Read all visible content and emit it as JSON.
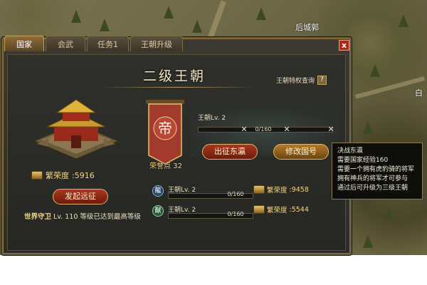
{
  "map": {
    "place_text": "后城郭",
    "side_text": "白"
  },
  "tabs": [
    {
      "label": "国家",
      "active": true
    },
    {
      "label": "会武",
      "active": false
    },
    {
      "label": "任务1",
      "active": false
    },
    {
      "label": "王朝升级",
      "active": false
    }
  ],
  "close_label": "x",
  "dynasty": {
    "title": "二级王朝",
    "privilege_label": "王朝特权查询",
    "privilege_btn": "?",
    "palace_honor_label": "繁荣度",
    "palace_honor_value": ":5916",
    "expedition_label": "发起远征",
    "guard_name": "世界守卫",
    "guard_info": "Lv. 110 等级已达到最高等级",
    "banner_glyph": "帝",
    "banner_points": "荣誉点 32",
    "level_label": "王朝Lv. 2",
    "progress_text": "0/160",
    "progress_fraction": 0,
    "conquer_label": "出征东瀛",
    "rename_label": "修改国号"
  },
  "generals": [
    {
      "icon": "龍",
      "level_label": "王朝Lv. 2",
      "progress_text": "0/160",
      "progress_fraction": 0,
      "honor_label": "繁荣度",
      "honor_value": ":9458"
    },
    {
      "icon": "猷",
      "level_label": "王朝Lv. 2",
      "progress_text": "0/160",
      "progress_fraction": 0,
      "honor_label": "繁荣度",
      "honor_value": ":5544"
    }
  ],
  "tooltip": {
    "lines": [
      "决战东瀛",
      "需要国家经验160",
      "需要一个拥有虎豹骑的将军",
      "拥有神兵的将军才可参与",
      "通过后可升级为三级王朝"
    ]
  },
  "colors": {
    "gold": "#f3d78a",
    "panel": "#2f302b",
    "accent_red": "#a8381e"
  }
}
